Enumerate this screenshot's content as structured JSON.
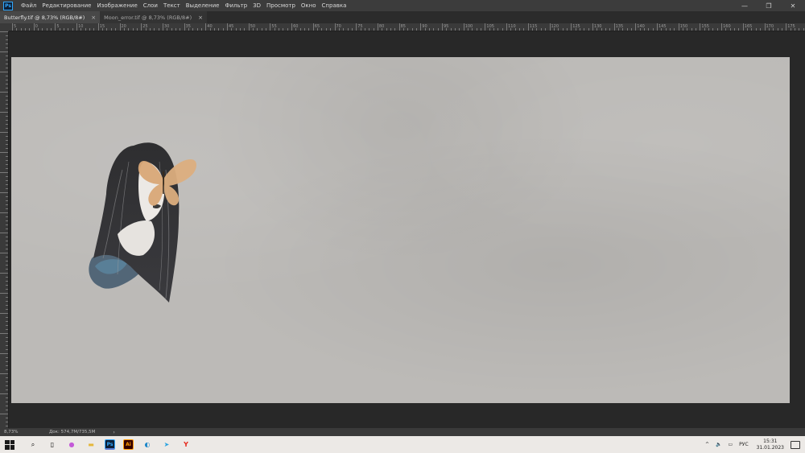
{
  "app": {
    "logo_text": "Ps"
  },
  "menu": {
    "items": [
      "Файл",
      "Редактирование",
      "Изображение",
      "Слои",
      "Текст",
      "Выделение",
      "Фильтр",
      "3D",
      "Просмотр",
      "Окно",
      "Справка"
    ]
  },
  "window_controls": {
    "minimize": "—",
    "maximize": "❐",
    "close": "✕"
  },
  "tabs": [
    {
      "label": "Butterfly.tif @ 8,73% (RGB/8#)",
      "active": true
    },
    {
      "label": "Moon_error.tif @ 8,73% (RGB/8#)",
      "active": false
    }
  ],
  "tab_close_glyph": "×",
  "ruler": {
    "top_labels": [
      "5",
      "0",
      "5",
      "10",
      "15",
      "20",
      "25",
      "30",
      "35",
      "40",
      "45",
      "50",
      "55",
      "60",
      "65",
      "70",
      "75",
      "80",
      "85",
      "90",
      "95",
      "100",
      "105",
      "110",
      "115",
      "120",
      "125",
      "130",
      "135",
      "140",
      "145",
      "150",
      "155",
      "160",
      "165",
      "170",
      "175"
    ]
  },
  "status": {
    "zoom": "8,73%",
    "doc_size": "Док: 574,7M/735,5M",
    "arrow": "›"
  },
  "taskbar": {
    "icons": [
      {
        "name": "search-icon",
        "glyph": "⌕"
      },
      {
        "name": "task-view-icon",
        "glyph": "▯"
      },
      {
        "name": "app-cloud-icon",
        "glyph": "●"
      },
      {
        "name": "file-explorer-icon",
        "glyph": "▬"
      },
      {
        "name": "photoshop-icon",
        "glyph": "Ps"
      },
      {
        "name": "illustrator-icon",
        "glyph": "Ai"
      },
      {
        "name": "edge-icon",
        "glyph": "◐"
      },
      {
        "name": "telegram-icon",
        "glyph": "➤"
      },
      {
        "name": "yandex-icon",
        "glyph": "Y"
      }
    ],
    "tray": {
      "chevron": "^",
      "speaker": "🔈",
      "network": "▭",
      "language": "РУС",
      "time": "15:31",
      "date": "31.01.2023"
    }
  },
  "colors": {
    "accent_ps": "#31a8ff",
    "accent_ai": "#ff9a00",
    "canvas": "#bcbab7"
  }
}
